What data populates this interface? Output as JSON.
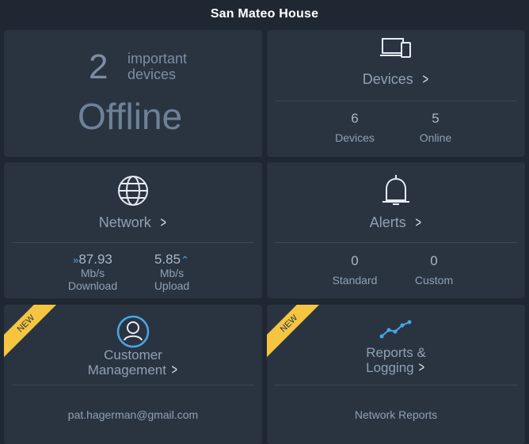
{
  "header": {
    "title": "San Mateo House"
  },
  "offline_card": {
    "count": "2",
    "label_line1": "important",
    "label_line2": "devices",
    "status": "Offline"
  },
  "devices_card": {
    "icon": "devices-icon",
    "title": "Devices",
    "stats": [
      {
        "value": "6",
        "label": "Devices"
      },
      {
        "value": "5",
        "label": "Online"
      }
    ]
  },
  "network_card": {
    "icon": "globe-icon",
    "title": "Network",
    "download": {
      "value": "87.93",
      "unit": "Mb/s",
      "label": "Download"
    },
    "upload": {
      "value": "5.85",
      "unit": "Mb/s",
      "label": "Upload"
    }
  },
  "alerts_card": {
    "icon": "bell-icon",
    "title": "Alerts",
    "stats": [
      {
        "value": "0",
        "label": "Standard"
      },
      {
        "value": "0",
        "label": "Custom"
      }
    ]
  },
  "customer_card": {
    "ribbon": "NEW",
    "icon": "user-icon",
    "title_line1": "Customer",
    "title_line2": "Management",
    "footer": "pat.hagerman@gmail.com"
  },
  "reports_card": {
    "ribbon": "NEW",
    "icon": "trend-line-icon",
    "title_line1": "Reports &",
    "title_line2": "Logging",
    "footer": "Network Reports"
  },
  "colors": {
    "accent": "#4aa6e8",
    "ribbon": "#f5c542",
    "card": "#2a3441",
    "background": "#1f2732"
  }
}
